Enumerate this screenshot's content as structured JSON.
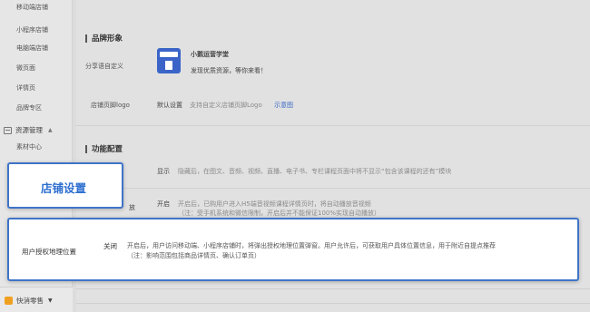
{
  "sidebar": {
    "items": [
      {
        "label": "移动端店铺"
      },
      {
        "label": "小程序店铺"
      },
      {
        "label": "电脑端店铺"
      },
      {
        "label": "微页面"
      },
      {
        "label": "详情页"
      },
      {
        "label": "品牌专区"
      }
    ],
    "section": {
      "label": "资源管理"
    },
    "sub_items": [
      {
        "label": "素材中心"
      }
    ],
    "bottom": {
      "label": "快消零售"
    }
  },
  "brand_section": {
    "title": "品牌形象",
    "share_label": "分享语自定义",
    "shop_name": "小鹅运营学堂",
    "share_text": "发现优质资源，等你来看！",
    "footer_logo_label": "店铺页脚logo",
    "footer_logo_value": "默认设置",
    "footer_logo_desc": "支持自定义店铺页脚Logo",
    "footer_logo_link": "示意图"
  },
  "function_section": {
    "title": "功能配置",
    "row1_status": "显示",
    "row1_desc": "隐藏后，在图文、音频、视频、直播、电子书、专栏课程页面中将不显示“包含该课程的还有”模块",
    "row2_status": "开启",
    "row2_desc": "开启后，已购用户进入H5端音视频课程详情页时，将自动播放音视频",
    "row2_note": "（注：受手机系统和微信限制，开启后并不能保证100%实现自动播放）",
    "row2_label_partial": "放"
  },
  "callout": {
    "label": "店铺设置"
  },
  "location_row": {
    "label": "用户授权地理位置",
    "status": "关闭",
    "desc": "开启后，用户访问移动端、小程序店铺时，将弹出授权地理位置弹窗。用户允许后，可获取用户具体位置信息，用于附近自提点推荐",
    "note": "（注：影响范围包括商品详情页、确认订单页）"
  }
}
